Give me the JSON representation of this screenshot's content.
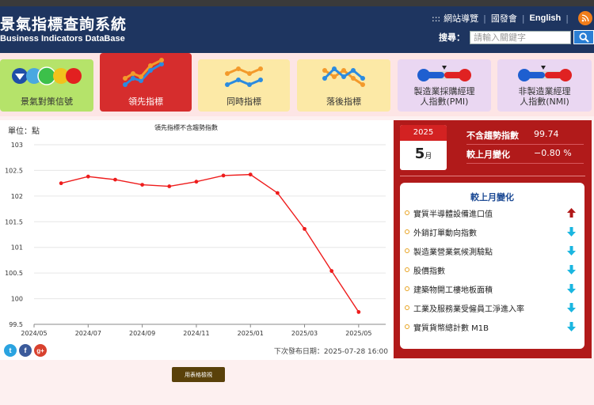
{
  "header": {
    "title_zh": "景氣指標查詢系統",
    "title_en": "Business Indicators DataBase",
    "nav_dots": ":::",
    "nav": [
      "網站導覽",
      "國發會",
      "English"
    ],
    "search_label": "搜尋：",
    "search_placeholder": "請輸入關鍵字"
  },
  "tabs": [
    {
      "label": "景氣對策信號"
    },
    {
      "label": "領先指標"
    },
    {
      "label": "同時指標"
    },
    {
      "label": "落後指標"
    },
    {
      "label_line1": "製造業採購經理",
      "label_line2": "人指數(PMI)"
    },
    {
      "label_line1": "非製造業經理",
      "label_line2": "人指數(NMI)"
    }
  ],
  "chart_panel": {
    "unit": "單位：點",
    "next_release": "下次發布日期：2025-07-28 16:00",
    "table_button": "用表格檢視"
  },
  "chart_data": {
    "type": "line",
    "title": "領先指標不含趨勢指數",
    "x": [
      "2024/06",
      "2024/07",
      "2024/08",
      "2024/09",
      "2024/10",
      "2024/11",
      "2024/12",
      "2025/01",
      "2025/02",
      "2025/03",
      "2025/04",
      "2025/05"
    ],
    "x_tick_labels": [
      "2024/05",
      "2024/07",
      "2024/09",
      "2024/11",
      "2025/01",
      "2025/03",
      "2025/05"
    ],
    "values": [
      102.25,
      102.38,
      102.32,
      102.22,
      102.19,
      102.28,
      102.4,
      102.42,
      102.06,
      101.36,
      100.54,
      99.74
    ],
    "ylim": [
      99.5,
      103
    ],
    "y_ticks": [
      "103",
      "102.5",
      "102",
      "101.5",
      "101",
      "100.5",
      "100",
      "99.5"
    ],
    "grid": true,
    "colors": {
      "line": "#ee1c1c"
    }
  },
  "latest": {
    "year": "2025",
    "month": "5",
    "month_unit": "月",
    "stat1_label": "不含趨勢指數",
    "stat1_value": "99.74",
    "stat2_label": "較上月變化",
    "stat2_value": "−0.80 %"
  },
  "changes": {
    "title": "較上月變化",
    "items": [
      {
        "label": "實質半導體設備進口值",
        "direction": "up"
      },
      {
        "label": "外銷訂單動向指數",
        "direction": "down"
      },
      {
        "label": "製造業營業氣候測驗點",
        "direction": "down"
      },
      {
        "label": "股價指數",
        "direction": "down"
      },
      {
        "label": "建築物開工樓地板面積",
        "direction": "down"
      },
      {
        "label": "工業及服務業受僱員工淨進入率",
        "direction": "down"
      },
      {
        "label": "實質貨幣總計數 M1B",
        "direction": "down"
      }
    ]
  },
  "colors": {
    "header_bg": "#1e3560",
    "accent_red": "#d62d2d",
    "panel_red": "#b11a1a",
    "arrow_up": "#b01818",
    "arrow_down": "#1ab6e0"
  }
}
